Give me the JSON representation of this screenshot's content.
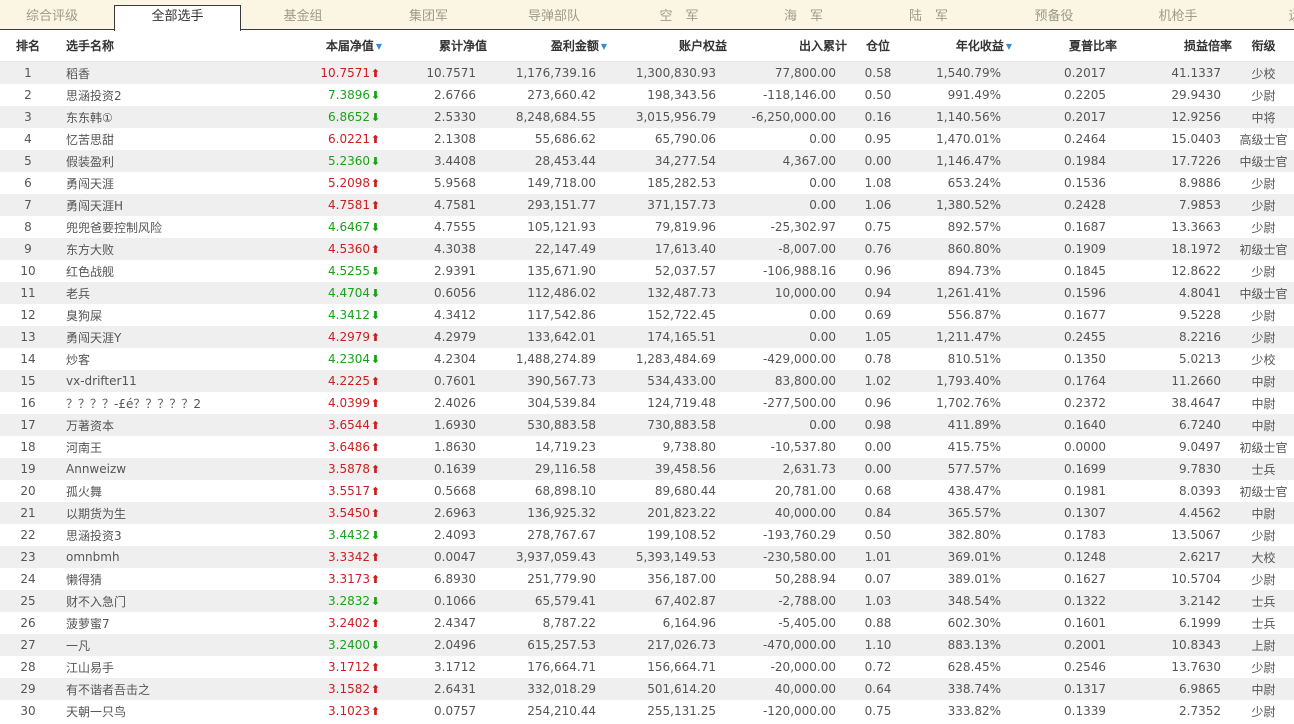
{
  "tabs": [
    {
      "label": "综合评级",
      "active": false
    },
    {
      "label": "全部选手",
      "active": true
    },
    {
      "label": "基金组",
      "active": false
    },
    {
      "label": "集团军",
      "active": false
    },
    {
      "label": "导弹部队",
      "active": false
    },
    {
      "label": "空　军",
      "active": false
    },
    {
      "label": "海　军",
      "active": false
    },
    {
      "label": "陆　军",
      "active": false
    },
    {
      "label": "预备役",
      "active": false
    },
    {
      "label": "机枪手",
      "active": false
    },
    {
      "label": "远",
      "active": false
    }
  ],
  "columns": {
    "rank": "排名",
    "name": "选手名称",
    "nav": "本届净值",
    "cum_nav": "累计净值",
    "profit": "盈利金额",
    "equity": "账户权益",
    "io": "出入累计",
    "position": "仓位",
    "annual": "年化收益",
    "sharpe": "夏普比率",
    "pl_ratio": "损益倍率",
    "title": "衔级"
  },
  "sort_indicator": "▼",
  "rows": [
    {
      "rank": "1",
      "name": "稻香",
      "nav": "10.7571",
      "trend": "up",
      "cum_nav": "10.7571",
      "profit": "1,176,739.16",
      "equity": "1,300,830.93",
      "io": "77,800.00",
      "position": "0.58",
      "annual": "1,540.79%",
      "sharpe": "0.2017",
      "pl_ratio": "41.1337",
      "title": "少校"
    },
    {
      "rank": "2",
      "name": "思涵投资2",
      "nav": "7.3896",
      "trend": "down",
      "cum_nav": "2.6766",
      "profit": "273,660.42",
      "equity": "198,343.56",
      "io": "-118,146.00",
      "position": "0.50",
      "annual": "991.49%",
      "sharpe": "0.2205",
      "pl_ratio": "29.9430",
      "title": "少尉"
    },
    {
      "rank": "3",
      "name": "东东韩①",
      "nav": "6.8652",
      "trend": "down",
      "cum_nav": "2.5330",
      "profit": "8,248,684.55",
      "equity": "3,015,956.79",
      "io": "-6,250,000.00",
      "position": "0.16",
      "annual": "1,140.56%",
      "sharpe": "0.2017",
      "pl_ratio": "12.9256",
      "title": "中将"
    },
    {
      "rank": "4",
      "name": "忆苦思甜",
      "nav": "6.0221",
      "trend": "up",
      "cum_nav": "2.1308",
      "profit": "55,686.62",
      "equity": "65,790.06",
      "io": "0.00",
      "position": "0.95",
      "annual": "1,470.01%",
      "sharpe": "0.2464",
      "pl_ratio": "15.0403",
      "title": "高级士官"
    },
    {
      "rank": "5",
      "name": "假装盈利",
      "nav": "5.2360",
      "trend": "down",
      "cum_nav": "3.4408",
      "profit": "28,453.44",
      "equity": "34,277.54",
      "io": "4,367.00",
      "position": "0.00",
      "annual": "1,146.47%",
      "sharpe": "0.1984",
      "pl_ratio": "17.7226",
      "title": "中级士官"
    },
    {
      "rank": "6",
      "name": "勇闯天涯",
      "nav": "5.2098",
      "trend": "up",
      "cum_nav": "5.9568",
      "profit": "149,718.00",
      "equity": "185,282.53",
      "io": "0.00",
      "position": "1.08",
      "annual": "653.24%",
      "sharpe": "0.1536",
      "pl_ratio": "8.9886",
      "title": "少尉"
    },
    {
      "rank": "7",
      "name": "勇闯天涯H",
      "nav": "4.7581",
      "trend": "up",
      "cum_nav": "4.7581",
      "profit": "293,151.77",
      "equity": "371,157.73",
      "io": "0.00",
      "position": "1.06",
      "annual": "1,380.52%",
      "sharpe": "0.2428",
      "pl_ratio": "7.9853",
      "title": "少尉"
    },
    {
      "rank": "8",
      "name": "兜兜爸要控制风险",
      "nav": "4.6467",
      "trend": "down",
      "cum_nav": "4.7555",
      "profit": "105,121.93",
      "equity": "79,819.96",
      "io": "-25,302.97",
      "position": "0.75",
      "annual": "892.57%",
      "sharpe": "0.1687",
      "pl_ratio": "13.3663",
      "title": "少尉"
    },
    {
      "rank": "9",
      "name": "东方大败",
      "nav": "4.5360",
      "trend": "up",
      "cum_nav": "4.3038",
      "profit": "22,147.49",
      "equity": "17,613.40",
      "io": "-8,007.00",
      "position": "0.76",
      "annual": "860.80%",
      "sharpe": "0.1909",
      "pl_ratio": "18.1972",
      "title": "初级士官"
    },
    {
      "rank": "10",
      "name": "红色战舰",
      "nav": "4.5255",
      "trend": "down",
      "cum_nav": "2.9391",
      "profit": "135,671.90",
      "equity": "52,037.57",
      "io": "-106,988.16",
      "position": "0.96",
      "annual": "894.73%",
      "sharpe": "0.1845",
      "pl_ratio": "12.8622",
      "title": "少尉"
    },
    {
      "rank": "11",
      "name": "老兵",
      "nav": "4.4704",
      "trend": "down",
      "cum_nav": "0.6056",
      "profit": "112,486.02",
      "equity": "132,487.73",
      "io": "10,000.00",
      "position": "0.94",
      "annual": "1,261.41%",
      "sharpe": "0.1596",
      "pl_ratio": "4.8041",
      "title": "中级士官"
    },
    {
      "rank": "12",
      "name": "臭狗屎",
      "nav": "4.3412",
      "trend": "down",
      "cum_nav": "4.3412",
      "profit": "117,542.86",
      "equity": "152,722.45",
      "io": "0.00",
      "position": "0.69",
      "annual": "556.87%",
      "sharpe": "0.1677",
      "pl_ratio": "9.5228",
      "title": "少尉"
    },
    {
      "rank": "13",
      "name": "勇闯天涯Y",
      "nav": "4.2979",
      "trend": "up",
      "cum_nav": "4.2979",
      "profit": "133,642.01",
      "equity": "174,165.51",
      "io": "0.00",
      "position": "1.05",
      "annual": "1,211.47%",
      "sharpe": "0.2455",
      "pl_ratio": "8.2216",
      "title": "少尉"
    },
    {
      "rank": "14",
      "name": "炒客",
      "nav": "4.2304",
      "trend": "down",
      "cum_nav": "4.2304",
      "profit": "1,488,274.89",
      "equity": "1,283,484.69",
      "io": "-429,000.00",
      "position": "0.78",
      "annual": "810.51%",
      "sharpe": "0.1350",
      "pl_ratio": "5.0213",
      "title": "少校"
    },
    {
      "rank": "15",
      "name": "vx-drifter11",
      "nav": "4.2225",
      "trend": "up",
      "cum_nav": "0.7601",
      "profit": "390,567.73",
      "equity": "534,433.00",
      "io": "83,800.00",
      "position": "1.02",
      "annual": "1,793.40%",
      "sharpe": "0.1764",
      "pl_ratio": "11.2660",
      "title": "中尉"
    },
    {
      "rank": "16",
      "name": "？？？？-£é？？？？？2",
      "nav": "4.0399",
      "trend": "up",
      "cum_nav": "2.4026",
      "profit": "304,539.84",
      "equity": "124,719.48",
      "io": "-277,500.00",
      "position": "0.96",
      "annual": "1,702.76%",
      "sharpe": "0.2372",
      "pl_ratio": "38.4647",
      "title": "中尉"
    },
    {
      "rank": "17",
      "name": "万著资本",
      "nav": "3.6544",
      "trend": "up",
      "cum_nav": "1.6930",
      "profit": "530,883.58",
      "equity": "730,883.58",
      "io": "0.00",
      "position": "0.98",
      "annual": "411.89%",
      "sharpe": "0.1640",
      "pl_ratio": "6.7240",
      "title": "中尉"
    },
    {
      "rank": "18",
      "name": "河南王",
      "nav": "3.6486",
      "trend": "up",
      "cum_nav": "1.8630",
      "profit": "14,719.23",
      "equity": "9,738.80",
      "io": "-10,537.80",
      "position": "0.00",
      "annual": "415.75%",
      "sharpe": "0.0000",
      "pl_ratio": "9.0497",
      "title": "初级士官"
    },
    {
      "rank": "19",
      "name": "Annweizw",
      "nav": "3.5878",
      "trend": "up",
      "cum_nav": "0.1639",
      "profit": "29,116.58",
      "equity": "39,458.56",
      "io": "2,631.73",
      "position": "0.00",
      "annual": "577.57%",
      "sharpe": "0.1699",
      "pl_ratio": "9.7830",
      "title": "士兵"
    },
    {
      "rank": "20",
      "name": "孤火舞",
      "nav": "3.5517",
      "trend": "up",
      "cum_nav": "0.5668",
      "profit": "68,898.10",
      "equity": "89,680.44",
      "io": "20,781.00",
      "position": "0.68",
      "annual": "438.47%",
      "sharpe": "0.1981",
      "pl_ratio": "8.0393",
      "title": "初级士官"
    },
    {
      "rank": "21",
      "name": "以期货为生",
      "nav": "3.5450",
      "trend": "up",
      "cum_nav": "2.6963",
      "profit": "136,925.32",
      "equity": "201,823.22",
      "io": "40,000.00",
      "position": "0.84",
      "annual": "365.57%",
      "sharpe": "0.1307",
      "pl_ratio": "4.4562",
      "title": "中尉"
    },
    {
      "rank": "22",
      "name": "思涵投资3",
      "nav": "3.4432",
      "trend": "down",
      "cum_nav": "2.4093",
      "profit": "278,767.67",
      "equity": "199,108.52",
      "io": "-193,760.29",
      "position": "0.50",
      "annual": "382.80%",
      "sharpe": "0.1783",
      "pl_ratio": "13.5067",
      "title": "少尉"
    },
    {
      "rank": "23",
      "name": "omnbmh",
      "nav": "3.3342",
      "trend": "up",
      "cum_nav": "0.0047",
      "profit": "3,937,059.43",
      "equity": "5,393,149.53",
      "io": "-230,580.00",
      "position": "1.01",
      "annual": "369.01%",
      "sharpe": "0.1248",
      "pl_ratio": "2.6217",
      "title": "大校"
    },
    {
      "rank": "24",
      "name": "懒得猜",
      "nav": "3.3173",
      "trend": "up",
      "cum_nav": "6.8930",
      "profit": "251,779.90",
      "equity": "356,187.00",
      "io": "50,288.94",
      "position": "0.07",
      "annual": "389.01%",
      "sharpe": "0.1627",
      "pl_ratio": "10.5704",
      "title": "少尉"
    },
    {
      "rank": "25",
      "name": "财不入急门",
      "nav": "3.2832",
      "trend": "down",
      "cum_nav": "0.1066",
      "profit": "65,579.41",
      "equity": "67,402.87",
      "io": "-2,788.00",
      "position": "1.03",
      "annual": "348.54%",
      "sharpe": "0.1322",
      "pl_ratio": "3.2142",
      "title": "士兵"
    },
    {
      "rank": "26",
      "name": "菠萝蜜7",
      "nav": "3.2402",
      "trend": "up",
      "cum_nav": "2.4347",
      "profit": "8,787.22",
      "equity": "6,164.96",
      "io": "-5,405.00",
      "position": "0.88",
      "annual": "602.30%",
      "sharpe": "0.1601",
      "pl_ratio": "6.1999",
      "title": "士兵"
    },
    {
      "rank": "27",
      "name": "一凡",
      "nav": "3.2400",
      "trend": "down",
      "cum_nav": "2.0496",
      "profit": "615,257.53",
      "equity": "217,026.73",
      "io": "-470,000.00",
      "position": "1.10",
      "annual": "883.13%",
      "sharpe": "0.2001",
      "pl_ratio": "10.8343",
      "title": "上尉"
    },
    {
      "rank": "28",
      "name": "江山易手",
      "nav": "3.1712",
      "trend": "up",
      "cum_nav": "3.1712",
      "profit": "176,664.71",
      "equity": "156,664.71",
      "io": "-20,000.00",
      "position": "0.72",
      "annual": "628.45%",
      "sharpe": "0.2546",
      "pl_ratio": "13.7630",
      "title": "少尉"
    },
    {
      "rank": "29",
      "name": "有不谐者吾击之",
      "nav": "3.1582",
      "trend": "up",
      "cum_nav": "2.6431",
      "profit": "332,018.29",
      "equity": "501,614.20",
      "io": "40,000.00",
      "position": "0.64",
      "annual": "338.74%",
      "sharpe": "0.1317",
      "pl_ratio": "6.9865",
      "title": "中尉"
    },
    {
      "rank": "30",
      "name": "天朝一只鸟",
      "nav": "3.1023",
      "trend": "up",
      "cum_nav": "0.0757",
      "profit": "254,210.44",
      "equity": "255,131.25",
      "io": "-120,000.00",
      "position": "0.75",
      "annual": "333.82%",
      "sharpe": "0.1339",
      "pl_ratio": "2.7352",
      "title": "少尉"
    }
  ]
}
